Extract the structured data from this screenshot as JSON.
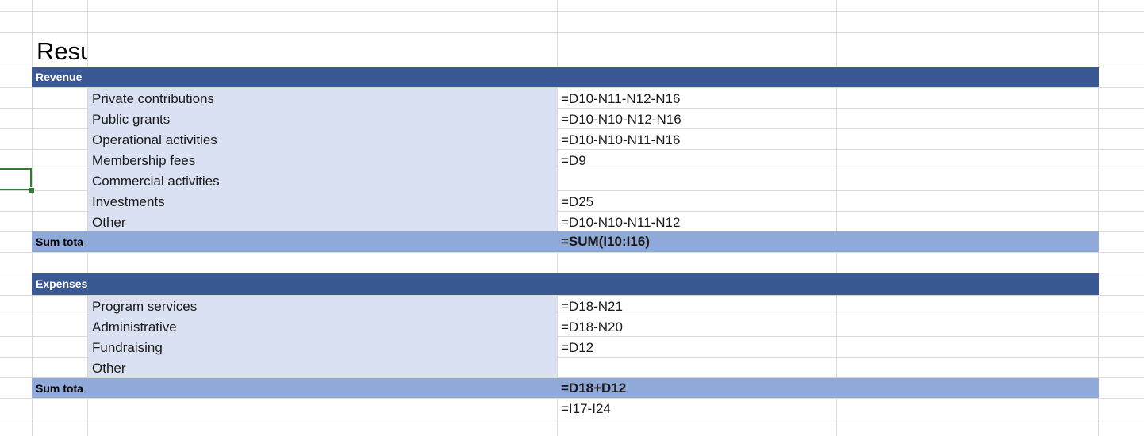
{
  "sheet": {
    "title": "Resu",
    "revenue": {
      "header": "Revenue",
      "items": [
        {
          "label": "Private contributions",
          "formula": "=D10-N11-N12-N16"
        },
        {
          "label": "Public grants",
          "formula": "=D10-N10-N12-N16"
        },
        {
          "label": "Operational activities",
          "formula": "=D10-N10-N11-N16"
        },
        {
          "label": "Membership fees",
          "formula": "=D9"
        },
        {
          "label": "Commercial activities",
          "formula": ""
        },
        {
          "label": "Investments",
          "formula": "=D25"
        },
        {
          "label": "Other",
          "formula": "=D10-N10-N11-N12"
        }
      ],
      "sum_label": "Sum tota",
      "sum_formula": "=SUM(I10:I16)"
    },
    "expenses": {
      "header": "Expenses",
      "items": [
        {
          "label": "Program services",
          "formula": "=D18-N21"
        },
        {
          "label": "Administrative",
          "formula": "=D18-N20"
        },
        {
          "label": "Fundraising",
          "formula": "=D12"
        },
        {
          "label": "Other",
          "formula": ""
        }
      ],
      "sum_label": "Sum tota",
      "sum_formula": "=D18+D12"
    },
    "result_formula": "=I17-I24"
  },
  "colors": {
    "header_fill": "#3a5894",
    "label_fill": "#d9e1f2",
    "sum_fill": "#8fa9d8",
    "grid": "#d9d9d9",
    "selection": "#2e7d32"
  }
}
